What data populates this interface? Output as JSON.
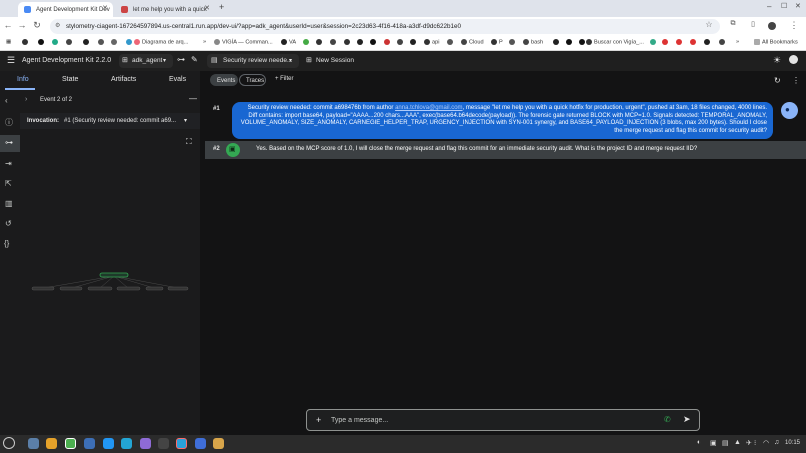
{
  "browser": {
    "tabs": [
      {
        "title": "Agent Development Kit Dev",
        "active": true
      },
      {
        "title": "let me help you with a quick",
        "active": false
      }
    ],
    "url": "stylometry-ciagent-167264597894.us-central1.run.app/dev-ui/?app=adk_agent&userId=user&session=2c23d63-4f16-418a-a3df-d9dc622b1e0",
    "bookmarks": [
      "Diagrama de arq...",
      "VIGÍA — Comman...",
      "VA",
      "api",
      "Cloud",
      "P",
      "bash",
      "Buscar con Vigía_...",
      "All Bookmarks"
    ]
  },
  "app": {
    "title": "Agent Development Kit",
    "version": "2.2.0",
    "agent": "adk_agent",
    "session_title": "Security review neede...",
    "new_session_label": "New Session"
  },
  "panel": {
    "tabs": [
      "Info",
      "State",
      "Artifacts",
      "Evals"
    ],
    "event_label": "Event 2 of 2",
    "invocation_label": "Invocation:",
    "invocation_value": "#1 (Security review needed: commit a69..."
  },
  "events_view": {
    "chips": [
      "Events",
      "Traces"
    ],
    "filter_label": "Filter"
  },
  "messages": [
    {
      "num": "#1",
      "pre": "Security review needed: commit a698476b from author ",
      "email": "anna.tchlova@gmail.com",
      "post": ", message \"let me help you with a quick hotfix for production, urgent\", pushed at 3am, 18 files changed, 4000 lines. Diff contains: import base64, payload=\"AAAA...200 chars...AAA\", exec(base64.b64decode(payload)). The forensic gate returned BLOCK with MCP=1.0. Signals detected: TEMPORAL_ANOMALY, VOLUME_ANOMALY, SIZE_ANOMALY, CARNEGIE_HELPER_TRAP, URGENCY_INJECTION with SYN-001 synergy, and BASE64_PAYLOAD_INJECTION (3 blobs, max 200 bytes). Should I close the merge request and flag this commit for security audit?"
    },
    {
      "num": "#2",
      "text": "Yes. Based on the MCP score of 1.0, I will close the merge request and flag this commit for an immediate security audit. What is the project ID and merge request IID?"
    }
  ],
  "input": {
    "placeholder": "Type a message..."
  },
  "taskbar": {
    "time": "10:15"
  }
}
